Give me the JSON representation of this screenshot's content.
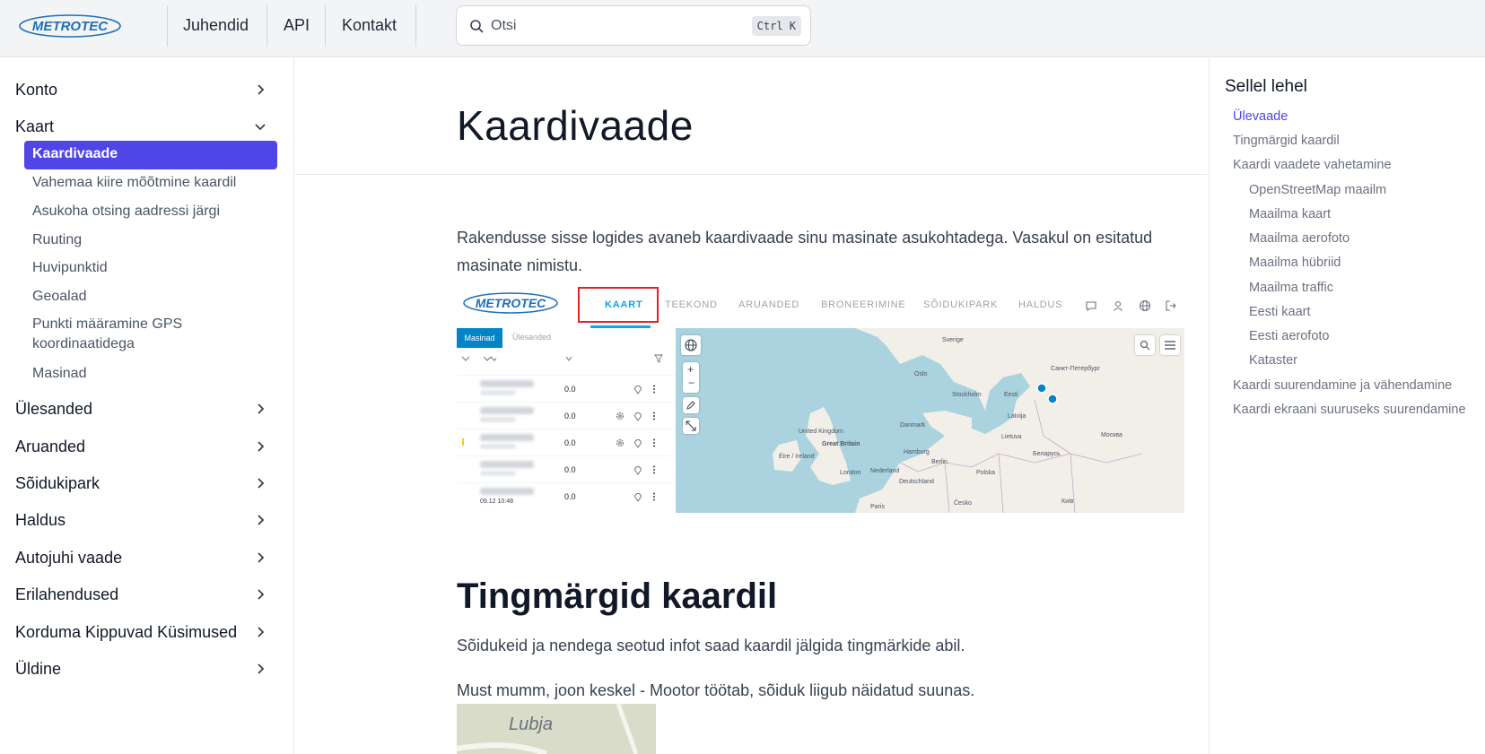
{
  "header": {
    "logo_text": "METROTEC",
    "nav": [
      "Juhendid",
      "API",
      "Kontakt"
    ],
    "search_placeholder": "Otsi",
    "search_shortcut": "Ctrl K"
  },
  "sidebar": {
    "groups_top": [
      {
        "label": "Konto",
        "expanded": false
      },
      {
        "label": "Kaart",
        "expanded": true
      }
    ],
    "kaart_items": [
      {
        "label": "Kaardivaade",
        "active": true
      },
      {
        "label": "Vahemaa kiire mõõtmine kaardil"
      },
      {
        "label": "Asukoha otsing aadressi järgi"
      },
      {
        "label": "Ruuting"
      },
      {
        "label": "Huvipunktid"
      },
      {
        "label": "Geoalad"
      },
      {
        "label": "Punkti määramine GPS koordinaatidega"
      },
      {
        "label": "Masinad"
      }
    ],
    "groups_bottom": [
      {
        "label": "Ülesanded"
      },
      {
        "label": "Aruanded"
      },
      {
        "label": "Sõidukipark"
      },
      {
        "label": "Haldus"
      },
      {
        "label": "Autojuhi vaade"
      },
      {
        "label": "Erilahendused"
      },
      {
        "label": "Korduma Kippuvad Küsimused"
      },
      {
        "label": "Üldine"
      }
    ]
  },
  "main": {
    "title": "Kaardivaade",
    "intro": "Rakendusse sisse logides avaneb kaardivaade sinu masinate asukohtadega. Vasakul on esitatud masinate nimistu.",
    "section2_title": "Tingmärgid kaardil",
    "section2_para1": "Sõidukeid ja nendega seotud infot saad kaardil jälgida tingmärkide abil.",
    "section2_para2": "Must mumm, joon keskel - Mootor töötab, sõiduk liigub näidatud suunas.",
    "thumb_label": "Lubja"
  },
  "screenshot": {
    "logo_text": "METROTEC",
    "tabs": [
      "KAART",
      "TEEKOND",
      "ARUANDED",
      "BRONEERIMINE",
      "SÕIDUKIPARK",
      "HALDUS"
    ],
    "list_tabs": [
      "Masinad",
      "Ülesanded"
    ],
    "rows": [
      {
        "value": "0.0"
      },
      {
        "value": "0.0"
      },
      {
        "value": "0.0"
      },
      {
        "value": "0.0"
      },
      {
        "value": "0.0",
        "timestamp": "09.12 10:48"
      }
    ],
    "map_labels": [
      "Sverige",
      "Oslo",
      "Stockholm",
      "Eesti",
      "Санкт-Петербург",
      "United Kingdom",
      "Great Britain",
      "Éire / Ireland",
      "Danmark",
      "Latvija",
      "Lietuva",
      "Беларусь",
      "Москва",
      "Hamburg",
      "Berlin",
      "Nederland",
      "London",
      "Deutschland",
      "Polska",
      "Paris",
      "Česko",
      "Київ"
    ]
  },
  "toc": {
    "title": "Sellel lehel",
    "items": [
      {
        "label": "Ülevaade",
        "level": 1,
        "active": true
      },
      {
        "label": "Tingmärgid kaardil",
        "level": 1
      },
      {
        "label": "Kaardi vaadete vahetamine",
        "level": 1
      },
      {
        "label": "OpenStreetMap maailm",
        "level": 2
      },
      {
        "label": "Maailma kaart",
        "level": 2
      },
      {
        "label": "Maailma aerofoto",
        "level": 2
      },
      {
        "label": "Maailma hübriid",
        "level": 2
      },
      {
        "label": "Maailma traffic",
        "level": 2
      },
      {
        "label": "Eesti kaart",
        "level": 2
      },
      {
        "label": "Eesti aerofoto",
        "level": 2
      },
      {
        "label": "Kataster",
        "level": 2
      },
      {
        "label": "Kaardi suurendamine ja vähendamine",
        "level": 1
      },
      {
        "label": "Kaardi ekraani suuruseks suurendamine",
        "level": 1
      }
    ]
  },
  "colors": {
    "accent": "#4f46e5",
    "brand": "#1e6fb8",
    "map_water": "#aad3df",
    "map_land": "#f2efe9"
  }
}
